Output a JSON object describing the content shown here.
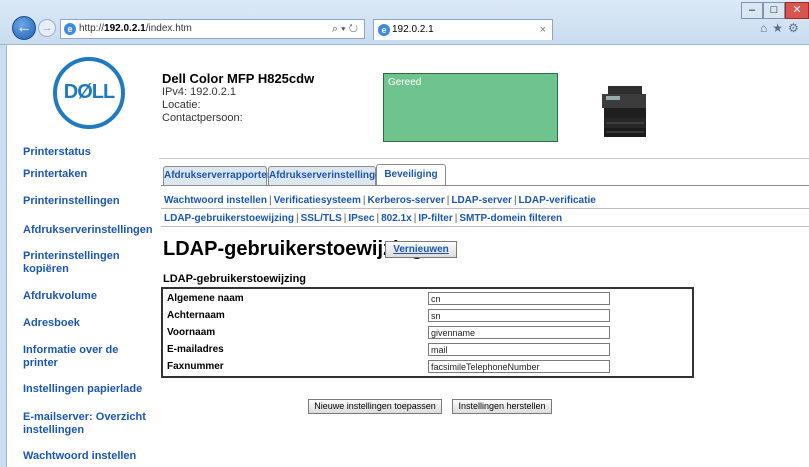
{
  "browser": {
    "url_prefix": "http://",
    "url_host": "192.0.2.1",
    "url_path": "/index.htm",
    "address_tools": "⌕ ▾ ↻",
    "tab_title": "192.0.2.1",
    "tab_close": "×",
    "window_min": "–",
    "window_max": "□",
    "window_close": "✕",
    "toolbar_icons": "⌂★⚙"
  },
  "logo_text": "DØLL",
  "sidebar": {
    "items": [
      "Printerstatus",
      "Printertaken",
      "Printerinstellingen",
      "Afdrukserverinstellingen",
      "Printerinstellingen kopiëren",
      "Afdrukvolume",
      "Adresboek",
      "Informatie over de printer",
      "Instellingen papierlade",
      "E-mailserver: Overzicht instellingen",
      "Wachtwoord instellen"
    ]
  },
  "header": {
    "model": "Dell Color MFP H825cdw",
    "ipv4": "IPv4: 192.0.2.1",
    "location": "Locatie:",
    "contact": "Contactpersoon:",
    "status": "Gereed",
    "status_color": "#6ec38f"
  },
  "tabs": [
    {
      "label": "Afdrukserverrapporten",
      "active": false
    },
    {
      "label": "Afdrukserverinstellingen",
      "active": false
    },
    {
      "label": "Beveiliging",
      "active": true
    }
  ],
  "sublinks_row1": [
    "Wachtwoord instellen",
    "Verificatiesysteem",
    "Kerberos-server",
    "LDAP-server",
    "LDAP-verificatie"
  ],
  "sublinks_row2": [
    "LDAP-gebruikerstoewijzing",
    "SSL/TLS",
    "IPsec",
    "802.1x",
    "IP-filter",
    "SMTP-domein filteren"
  ],
  "page": {
    "title": "LDAP-gebruikerstoewijzing -",
    "refresh_label": "Vernieuwen",
    "section_title": "LDAP-gebruikerstoewijzing",
    "fields": [
      {
        "label": "Algemene naam",
        "value": "cn"
      },
      {
        "label": "Achternaam",
        "value": "sn"
      },
      {
        "label": "Voornaam",
        "value": "givenname"
      },
      {
        "label": "E-mailadres",
        "value": "mail"
      },
      {
        "label": "Faxnummer",
        "value": "facsimileTelephoneNumber"
      }
    ],
    "apply_label": "Nieuwe instellingen toepassen",
    "reset_label": "Instellingen herstellen"
  },
  "colors": {
    "link": "#1a56b0",
    "logo": "#1f7ac0"
  }
}
